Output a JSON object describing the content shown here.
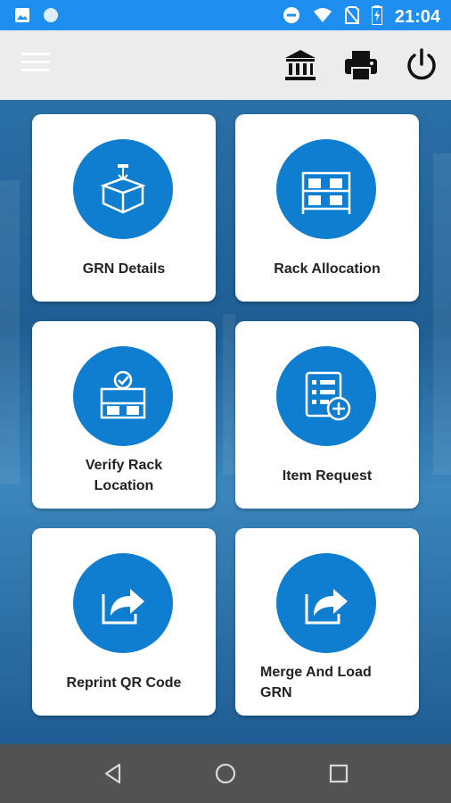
{
  "status_bar": {
    "time": "21:04",
    "left_icons": [
      "image-icon",
      "circle-icon"
    ],
    "right_icons": [
      "do-not-disturb-icon",
      "wifi-icon",
      "no-sim-icon",
      "battery-charging-icon"
    ]
  },
  "app_bar": {
    "actions": [
      "bank-icon",
      "printer-icon",
      "power-icon"
    ]
  },
  "tiles": [
    {
      "label": "GRN Details",
      "icon": "package-icon"
    },
    {
      "label": "Rack Allocation",
      "icon": "rack-icon"
    },
    {
      "label": "Verify Rack\nLocation",
      "icon": "verify-rack-icon"
    },
    {
      "label": "Item Request",
      "icon": "list-add-icon"
    },
    {
      "label": "Reprint QR Code",
      "icon": "share-icon"
    },
    {
      "label": "Merge And Load\nGRN",
      "icon": "share-icon"
    }
  ],
  "colors": {
    "status_bar": "#1e8ff0",
    "accent": "#0f7ed0",
    "app_bar": "#ececec",
    "nav_bar": "#525252"
  }
}
